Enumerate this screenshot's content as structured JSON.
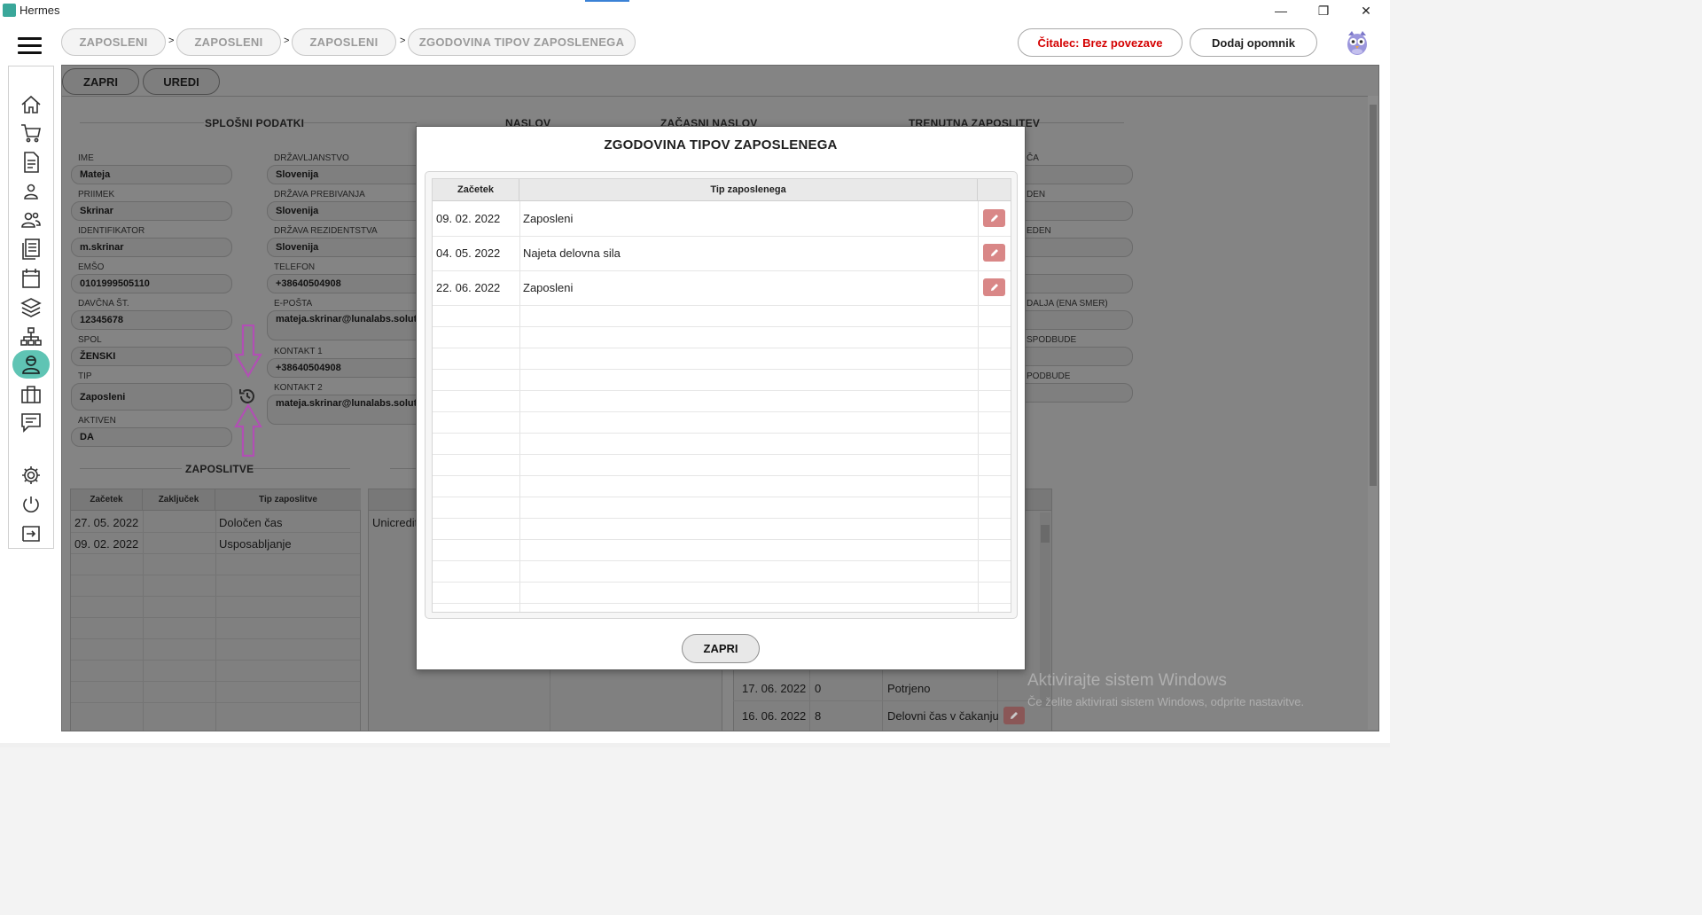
{
  "window": {
    "title": "Hermes",
    "minimize": "—",
    "maximize": "❐",
    "close": "✕"
  },
  "breadcrumb": [
    {
      "label": "ZAPOSLENI"
    },
    {
      "label": "ZAPOSLENI"
    },
    {
      "label": "ZAPOSLENI"
    },
    {
      "label": "ZGODOVINA TIPOV ZAPOSLENEGA"
    }
  ],
  "breadcrumb_separator": ">",
  "header": {
    "reader_status": "Čitalec: Brez povezave",
    "reader_status_color": "#d40000",
    "add_reminder": "Dodaj opomnik"
  },
  "sidebar": {
    "accent": "#5fc4b4",
    "items": [
      {
        "icon": "home-icon"
      },
      {
        "icon": "cart-icon"
      },
      {
        "icon": "document-icon"
      },
      {
        "icon": "person-icon"
      },
      {
        "icon": "people-icon"
      },
      {
        "icon": "list-document-icon"
      },
      {
        "icon": "calendar-icon"
      },
      {
        "icon": "layers-icon"
      },
      {
        "icon": "hierarchy-icon"
      },
      {
        "icon": "employee-icon",
        "active": true
      },
      {
        "icon": "briefcase-icon"
      },
      {
        "icon": "chat-icon"
      },
      {
        "icon": "gear-icon"
      },
      {
        "icon": "power-icon"
      },
      {
        "icon": "logout-icon"
      }
    ]
  },
  "toolbar": {
    "close": "ZAPRI",
    "edit": "UREDI"
  },
  "sections": {
    "general": "SPLOŠNI PODATKI",
    "address": "NASLOV",
    "temp_address": "ZAČASNI NASLOV",
    "current_employment": "TRENUTNA ZAPOSLITEV",
    "employments": "ZAPOSLITVE"
  },
  "general_left": [
    {
      "label": "IME",
      "value": "Mateja"
    },
    {
      "label": "PRIIMEK",
      "value": "Skrinar"
    },
    {
      "label": "IDENTIFIKATOR",
      "value": "m.skrinar"
    },
    {
      "label": "EMŠO",
      "value": "0101999505110"
    },
    {
      "label": "DAVČNA ŠT.",
      "value": "12345678"
    },
    {
      "label": "SPOL",
      "value": "ŽENSKI"
    },
    {
      "label": "TIP",
      "value": "Zaposleni"
    },
    {
      "label": "AKTIVEN",
      "value": "DA"
    }
  ],
  "general_right": [
    {
      "label": "DRŽAVLJANSTVO",
      "value": "Slovenija"
    },
    {
      "label": "DRŽAVA PREBIVANJA",
      "value": "Slovenija"
    },
    {
      "label": "DRŽAVA REZIDENTSTVA",
      "value": "Slovenija"
    },
    {
      "label": "TELEFON",
      "value": "+38640504908"
    },
    {
      "label": "E-POŠTA",
      "value": "mateja.skrinar@lunalabs.solutions"
    },
    {
      "label": "KONTAKT 1",
      "value": "+38640504908"
    },
    {
      "label": "KONTAKT 2",
      "value": "mateja.skrinar@lunalabs.solutions"
    }
  ],
  "current_employment_labels": [
    "ČA",
    "DEN",
    "EDEN",
    "",
    "DALJA (ENA SMER)",
    "SPODBUDE",
    "PODBUDE"
  ],
  "employments_table": {
    "headers": [
      "Začetek",
      "Zaključek",
      "Tip zaposlitve"
    ],
    "rows": [
      [
        "27. 05. 2022",
        "",
        "Določen čas"
      ],
      [
        "09. 02. 2022",
        "",
        "Usposabljanje"
      ]
    ]
  },
  "bank_partial": "Unicredit",
  "background_rows": [
    {
      "date": "17. 06. 2022",
      "num": "0",
      "status": "Potrjeno"
    },
    {
      "date": "16. 06. 2022",
      "num": "8",
      "status": "Delovni čas v čakanju"
    }
  ],
  "annotation_color": "#b14fb4",
  "modal": {
    "title": "ZGODOVINA TIPOV ZAPOSLENEGA",
    "headers": [
      "Začetek",
      "Tip zaposlenega"
    ],
    "rows": [
      {
        "start": "09. 02. 2022",
        "type": "Zaposleni"
      },
      {
        "start": "04. 05. 2022",
        "type": "Najeta delovna sila"
      },
      {
        "start": "22. 06. 2022",
        "type": "Zaposleni"
      }
    ],
    "edit_color": "#d98787",
    "close": "ZAPRI"
  },
  "watermark": {
    "line1": "Aktivirajte sistem Windows",
    "line2": "Če želite aktivirati sistem Windows, odprite nastavitve."
  }
}
